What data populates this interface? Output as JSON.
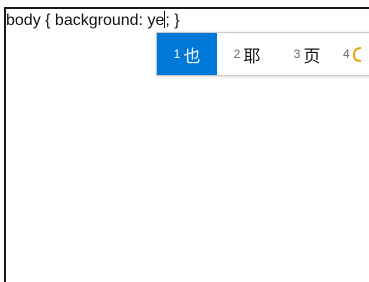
{
  "editor": {
    "code_before_caret": "body { background: ye",
    "code_after_caret": "; }"
  },
  "ime": {
    "accent_color": "#0078d7",
    "candidates": [
      {
        "num": "1",
        "text": "也",
        "selected": true
      },
      {
        "num": "2",
        "text": "耶",
        "selected": false
      },
      {
        "num": "3",
        "text": "页",
        "selected": false
      },
      {
        "num": "4",
        "text": "",
        "selected": false
      }
    ]
  }
}
